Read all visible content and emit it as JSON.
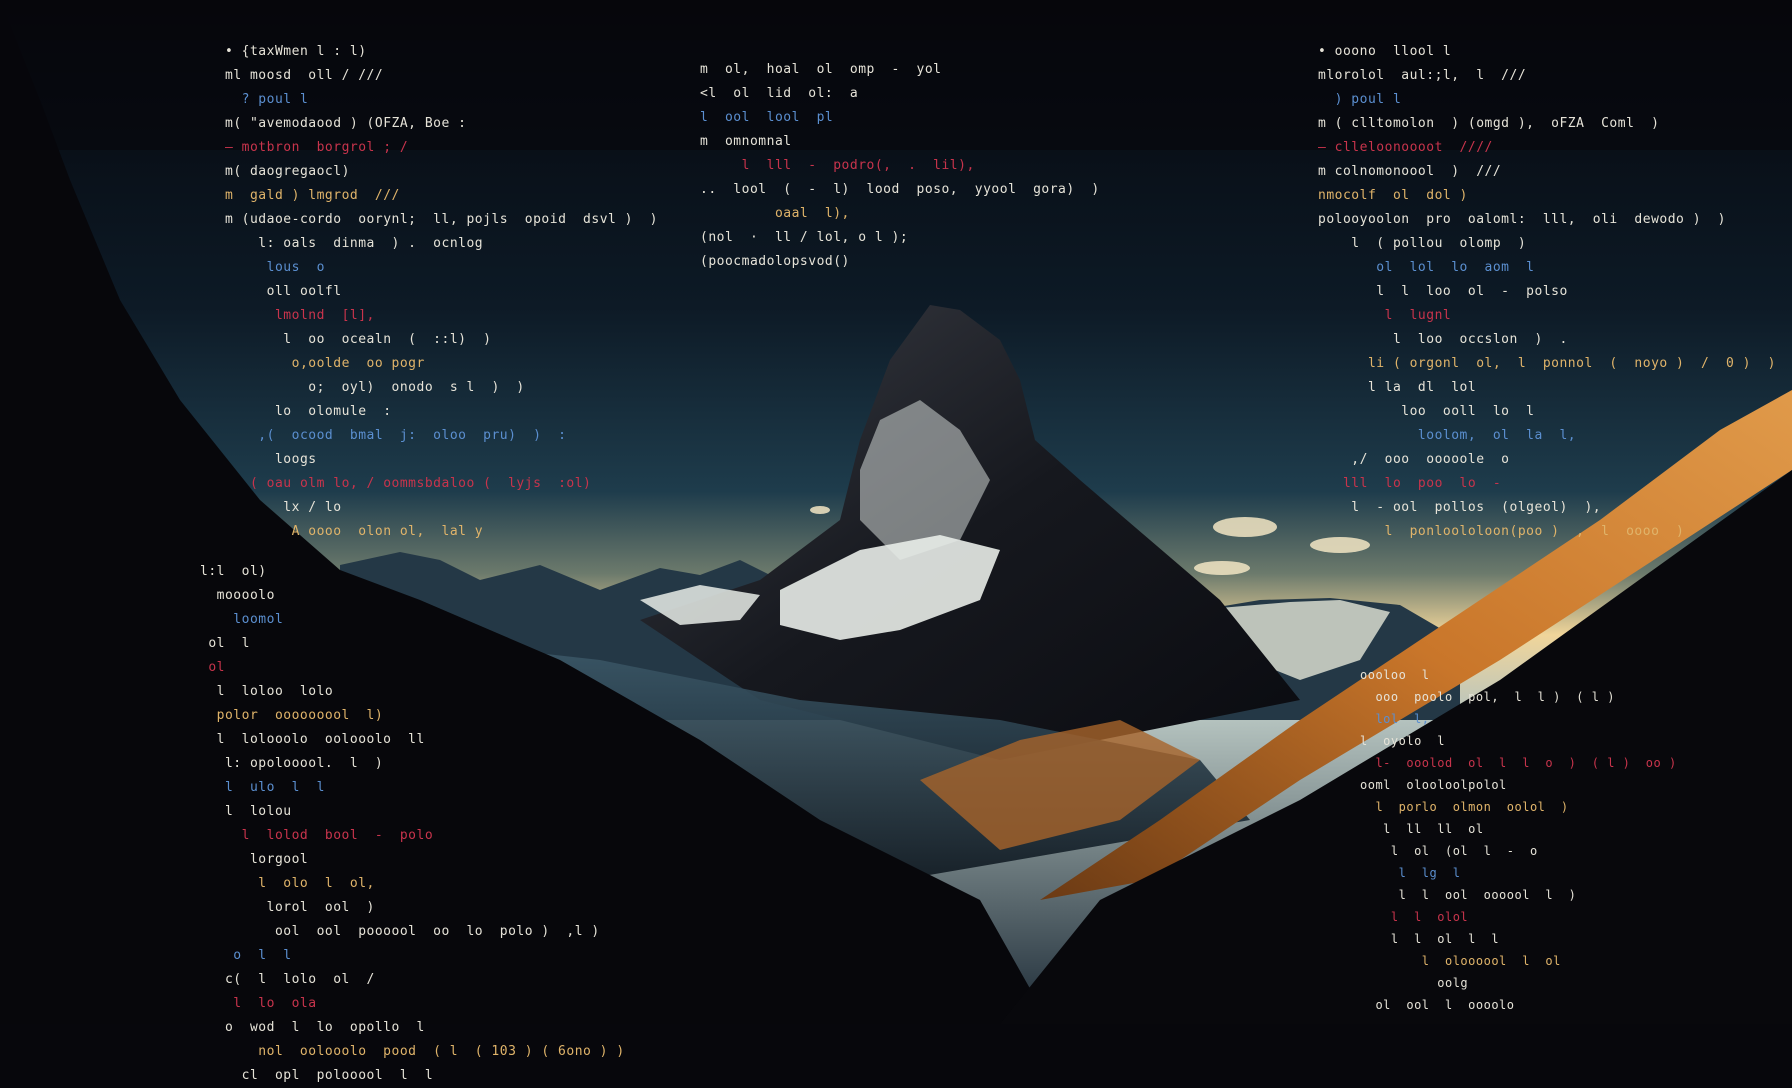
{
  "scene": {
    "colors": {
      "sky_top": "#05060b",
      "sky_mid": "#1c3a4c",
      "sky_horizon": "#f0d59a",
      "mountain_dark": "#1a1c22",
      "snow": "#e8ece8",
      "slope_orange": "#c9762a",
      "code_white": "#e6e3d8",
      "code_red": "#c8344c",
      "code_blue": "#5b8fd0"
    }
  },
  "code_left": [
    "• {taxWmen l : l)",
    "ml moosd  oll / ///",
    "  ? poul l",
    "m( \"avemodaood ) (OFZA, Boe :",
    "– motbron  borgrol ; /",
    "m( daogregaocl)",
    "m  gald ) lmgrod  ///",
    "m (udaoe-cordo  oorynl;  ll, pojls  opoid  dsvl )  )",
    "    l: oals  dinma  ) .  ocnlog",
    "     lous  o",
    "     oll oolfl",
    "      lmolnd  [l],",
    "       l  oo  ocealn  (  ::l)  )",
    "        o,oolde  oo pogr",
    "          o;  oyl)  onodo  s l  )  )",
    "      lo  olomule  :",
    "    ,(  ocood  bmal  j:  oloo  pru)  )  :",
    "      loogs",
    "   ( oau olm lo, / oommsbdaloo (  lyjs  :ol)",
    "       lx / lo",
    "        A oooo  olon ol,  lal y"
  ],
  "code_top": [
    "m  ol,  hoal  ol  omp  -  yol",
    "<l  ol  lid  ol:  a",
    "l  ool  lool  pl",
    "m  omnomnal",
    "     l  lll  -  podro(,  .  lil),",
    "..  lool  (  -  l)  lood  poso,  yyool  gora)  )",
    "         oaal  l),",
    "(nol  ·  ll / lol, o l );",
    "(poocmadolopsvod()"
  ],
  "code_right": [
    "• ooono  llool l",
    "mlorolol  aul:;l,  l  ///",
    "  ) poul l",
    "m ( clltomolon  ) (omgd ),  oFZA  Coml  )",
    "– clleloonoooot  ////",
    "m colnomonoool  )  ///",
    "nmocolf  ol  dol )",
    "polooyoolon  pro  oaloml:  lll,  oli  dewodo )  )",
    "    l  ( pollou  olomp  )",
    "       ol  lol  lo  aom  l",
    "       l  l  loo  ol  -  polso",
    "        l  lugnl",
    "         l  loo  occslon  )  .",
    "      li ( orgonl  ol,  l  ponnol  (  noyo )  /  0 )  )",
    "      l la  dl  lol",
    "          loo  ooll  lo  l",
    "            loolom,  ol  la  l,",
    "    ,/  ooo  ooooole  o",
    "   lll  lo  poo  lo  -",
    "    l  - ool  pollos  (olgeol)  ),",
    "        l  ponloololoon(poo )  ,  l  oooo  )"
  ],
  "code_bottom_left": [
    "l:l  ol)",
    "  moooolo",
    "    loomol",
    " ol  l",
    " ol",
    "  l  loloo  lolo",
    "  polor  ooooooool  l)",
    "  l  lolooolo  oolooolo  ll",
    "   l: opolooool.  l  )",
    "   l  ulo  l  l",
    "   l  lolou",
    "     l  lolod  bool  -  polo",
    "      lorgool",
    "       l  olo  l  ol,",
    "        lorol  ool  )",
    "         ool  ool  poooool  oo  lo  polo )  ,l )",
    "    o  l  l",
    "   c(  l  lolo  ol  /",
    "    l  lo  ola",
    "   o  wod  l  lo  opollo  l",
    "       nol  oolooolo  pood  ( l  ( 103 ) ( 6ono ) )",
    "     cl  opl  polooool  l  l"
  ],
  "code_bottom_right": [
    "oooloo  l",
    "  ooo  poolo  pol,  l  l )  ( l )",
    "  lol  l,",
    "l  oyolo  l",
    "  l-  ooolod  ol  l  l  o  )  ( l )  oo )",
    "ooml  olooloolpolol",
    "  l  porlo  olmon  oolol  )",
    "   l  ll  ll  ol",
    "    l  ol  (ol  l  -  o",
    "     l  lg  l",
    "     l  l  ool  oooool  l  )",
    "    l  l  olol",
    "    l  l  ol  l  l",
    "        l  oloooool  l  ol",
    "          oolg",
    "  ol  ool  l  oooolo"
  ]
}
